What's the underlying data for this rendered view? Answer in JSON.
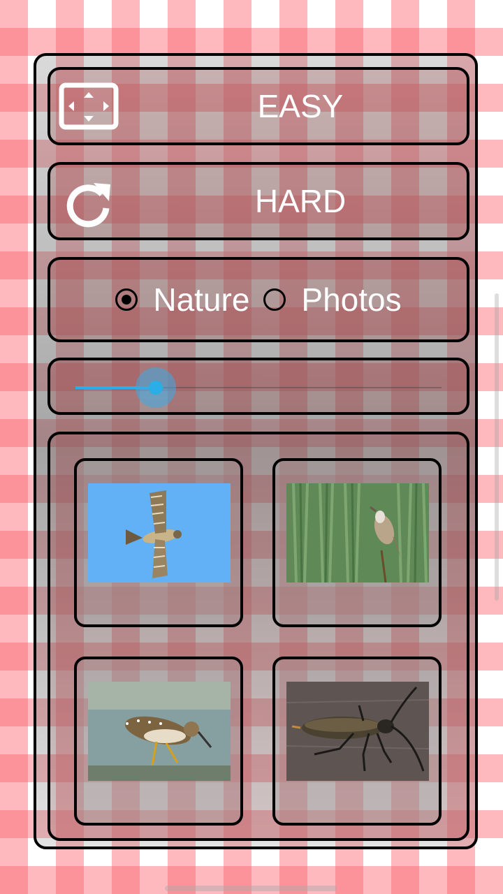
{
  "buttons": {
    "easy_label": "EASY",
    "hard_label": "HARD"
  },
  "category": {
    "options": [
      {
        "label": "Nature",
        "selected": true
      },
      {
        "label": "Photos",
        "selected": false
      }
    ]
  },
  "slider": {
    "value_fraction": 0.22,
    "accent_color": "#2aaee8"
  },
  "images": [
    {
      "subject": "hawk-in-flight"
    },
    {
      "subject": "warbler-on-reed"
    },
    {
      "subject": "sandpiper-wading"
    },
    {
      "subject": "longhorn-beetle"
    }
  ],
  "icons": {
    "easy": "fullscreen-icon",
    "hard": "refresh-icon"
  }
}
